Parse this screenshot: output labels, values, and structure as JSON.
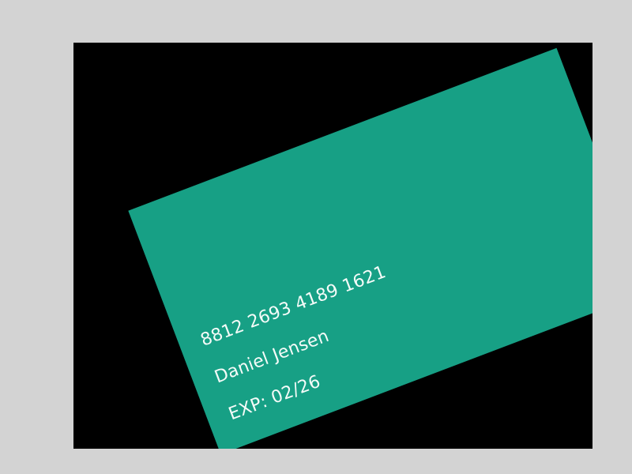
{
  "card": {
    "background_color": "#17a085",
    "number": "8812 2693 4189 1621",
    "holder_name": "Daniel Jensen",
    "expiry": "EXP: 02/26"
  }
}
